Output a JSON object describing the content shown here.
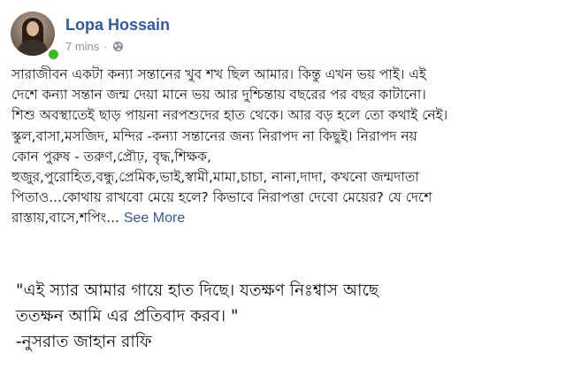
{
  "post": {
    "author": "Lopa Hossain",
    "timestamp": "7 mins",
    "separator": "·",
    "privacy_icon": "globe-icon",
    "body": "সারাজীবন একটা কন্যা সন্তানের খুব শখ ছিল আমার। কিন্তু এখন ভয় পাই। এই\nদেশে কন্যা সন্তান জন্ম দেয়া মানে ভয় আর দুশ্চিন্তায় বছরের পর বছর কাটানো।\nশিশু অবস্থাতেই ছাড় পায়না নরপশুদের হাত থেকে। আর বড় হলে তো কথাই নেই।\nস্কুল,বাসা,মসজিদ, মন্দির -কন্যা সন্তানের জন্য নিরাপদ না কিছুই। নিরাপদ নয়\nকোন পুরুষ - তরুণ,প্রৌঢ়, বৃদ্ধ,শিক্ষক,\nহুজুর,পুরোহিত,বন্ধু,প্রেমিক,ভাই,স্বামী,মামা,চাচা, নানা,দাদা, কখনো জন্মদাতা\nপিতাও...কোথায় রাখবো মেয়ে হলে? কিভাবে নিরাপত্তা দেবো মেয়ের? যে দেশে\nরাস্তায়,বাসে,শপিং... ",
    "see_more": "See More"
  },
  "quote": {
    "text": "\"এই স্যার আমার গায়ে হাত দিছে। যতক্ষণ নিঃশ্বাস আছে\nততক্ষন আমি এর প্রতিবাদ করব। \"\n-নুসরাত জাহান রাফি"
  },
  "colors": {
    "author": "#385898",
    "meta": "#90949c",
    "online": "#42b72a",
    "text": "#1c1e21"
  }
}
